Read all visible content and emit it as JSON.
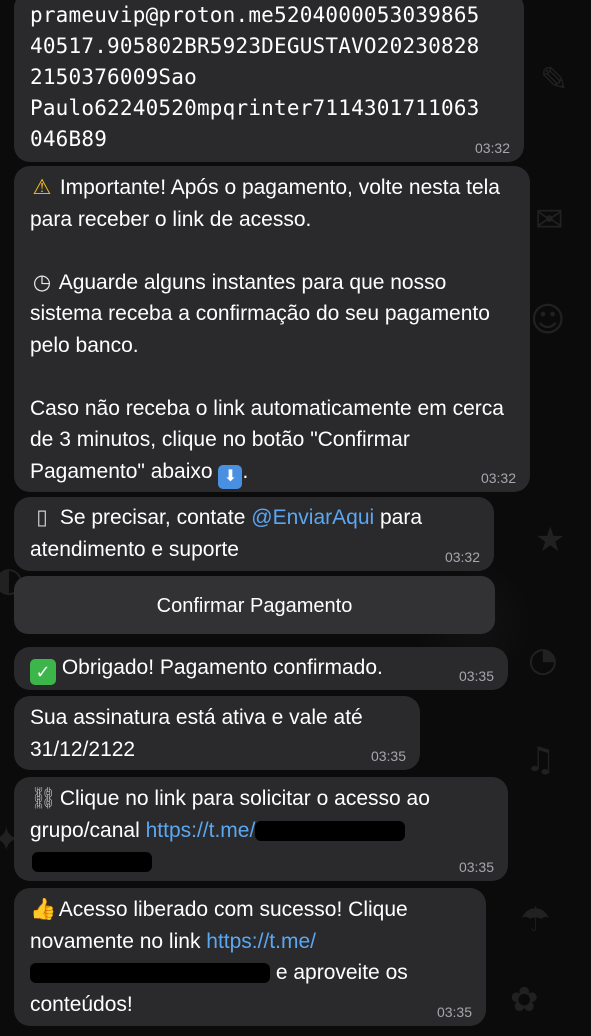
{
  "messages": {
    "pix_code": {
      "lines": [
        "prameuvip@proton.me5204000053039865",
        "40517.905802BR5923DEGUSTAVO20230828",
        "2150376009Sao",
        "Paulo62240520mpqrinter7114301711063",
        "046B89"
      ],
      "time": "03:32"
    },
    "important": {
      "warn_icon": "warning-icon",
      "p1": "Importante! Após o pagamento, volte nesta tela para receber o link de acesso.",
      "clock_icon": "clock-icon",
      "p2": "Aguarde alguns instantes para que nosso sistema receba a confirmação do seu pagamento pelo banco.",
      "p3": "Caso não receba o link automaticamente em cerca de 3 minutos, clique no botão \"Confirmar Pagamento\" abaixo",
      "down_icon": "down-arrow-icon",
      "p3_end": ".",
      "time": "03:32"
    },
    "support": {
      "phone_icon": "mobile-phone-icon",
      "text_before": "Se precisar, contate ",
      "link": "@EnviarAqui",
      "text_after": " para atendimento e suporte",
      "time": "03:32"
    },
    "confirm_button": "Confirmar Pagamento",
    "thanks": {
      "check_icon": "check-mark-icon",
      "text": "Obrigado! Pagamento confirmado.",
      "time": "03:35"
    },
    "subscription": {
      "text": "Sua assinatura está ativa e vale até 31/12/2122",
      "time": "03:35"
    },
    "request_link": {
      "chain_icon": "link-chain-icon",
      "text": "Clique no link para solicitar o acesso ao grupo/canal ",
      "link": "https://t.me/",
      "time": "03:35"
    },
    "access": {
      "thumb_icon": "thumbs-up-icon",
      "text": "Acesso liberado com sucesso! Clique novamente no link ",
      "link": "https://t.me/",
      "text_after": " e aproveite os conteúdos!",
      "time": "03:35"
    }
  },
  "colors": {
    "bubble": "#2a292b",
    "link": "#5aa7f2",
    "timestamp": "#a7a6ab",
    "background": "#0b0b0b"
  }
}
